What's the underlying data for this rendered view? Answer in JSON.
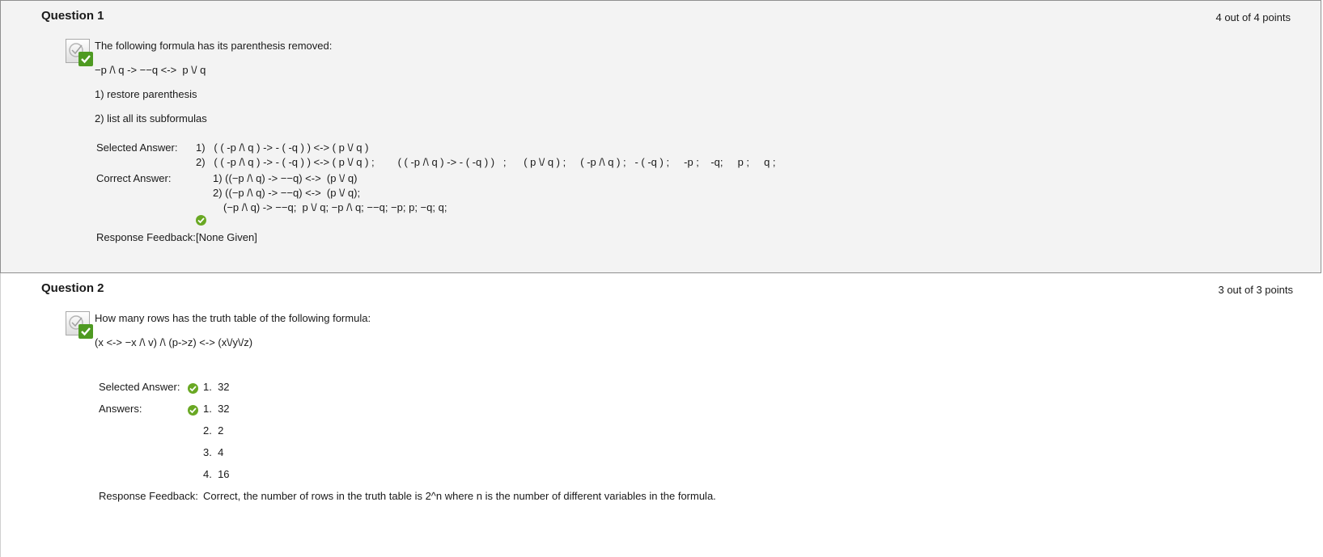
{
  "question1": {
    "title": "Question 1",
    "points": "4 out of 4 points",
    "prompt": "The following formula has its parenthesis removed:",
    "formula": "−p /\\ q -> −−q <->  p \\/ q",
    "task1": "1) restore parenthesis",
    "task2": "2) list all its subformulas",
    "selected_label": "Selected Answer:",
    "selected_lines": [
      "1)   ( ( -p /\\ q ) -> - ( -q ) ) <-> ( p \\/ q )",
      "2)   ( ( -p /\\ q ) -> - ( -q ) ) <-> ( p \\/ q ) ;        ( ( -p /\\ q ) -> - ( -q ) )   ;      ( p \\/ q ) ;     ( -p /\\ q ) ;   - ( -q ) ;     -p ;    -q;     p ;     q ;"
    ],
    "correct_label": "Correct Answer:",
    "correct_lines": [
      "1) ((−p /\\ q) -> −−q) <->  (p \\/ q)",
      "2) ((−p /\\ q) -> −−q) <->  (p \\/ q);",
      "(−p /\\ q) -> −−q;  p \\/ q; −p /\\ q; −−q; −p; p; −q; q;"
    ],
    "feedback_label": "Response Feedback:",
    "feedback": "[None Given]",
    "icons": {
      "status": "graded-correct-icon",
      "answer": "correct-check-icon"
    }
  },
  "question2": {
    "title": "Question 2",
    "points": "3 out of 3 points",
    "prompt": "How many rows has the truth table of the following formula:",
    "formula": "(x <-> −x /\\ v) /\\ (p->z) <-> (x\\/y\\/z)",
    "selected_label": "Selected Answer:",
    "selected_answer": "1.  32",
    "answers_label": "Answers:",
    "answers": [
      "1.  32",
      "2.  2",
      "3.  4",
      "4.  16"
    ],
    "feedback_label": "Response Feedback:",
    "feedback": "Correct, the number of rows in the truth table is 2^n where n is the number of different variables in the formula.",
    "icons": {
      "status": "graded-correct-icon",
      "answer": "correct-check-icon"
    }
  },
  "colors": {
    "question_bg": "#f3f3f3",
    "border": "#8f8f8f",
    "correct_green": "#69a823",
    "badge_green": "#4e9a22"
  }
}
